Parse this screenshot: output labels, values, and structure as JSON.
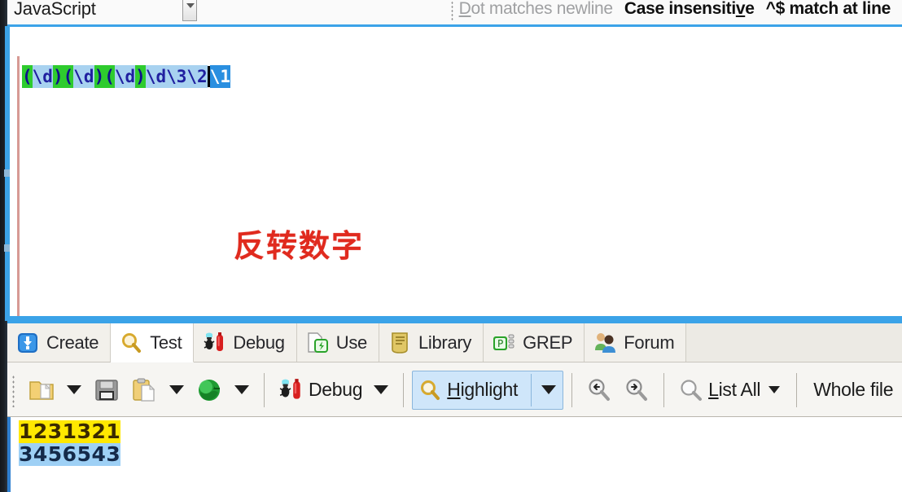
{
  "topbar": {
    "language": "JavaScript",
    "language_dropdown_icon": "chevron-down-icon",
    "options": [
      {
        "label": "Dot matches newline",
        "state": "disabled",
        "accel": "D"
      },
      {
        "label": "Case insensitive",
        "state": "enabled",
        "accel": "v"
      },
      {
        "label": "^$ match at line",
        "state": "enabled",
        "accel": ""
      }
    ]
  },
  "regex": {
    "pattern": "(\\d)(\\d)(\\d)\\d\\3\\2\\1",
    "tokens": [
      {
        "text": "(",
        "kind": "group"
      },
      {
        "text": "\\d",
        "kind": "literal"
      },
      {
        "text": ")",
        "kind": "group"
      },
      {
        "text": "(",
        "kind": "group"
      },
      {
        "text": "\\d",
        "kind": "literal"
      },
      {
        "text": ")",
        "kind": "group"
      },
      {
        "text": "(",
        "kind": "group"
      },
      {
        "text": "\\d",
        "kind": "literal"
      },
      {
        "text": ")",
        "kind": "group"
      },
      {
        "text": "\\d\\3\\2",
        "kind": "literal"
      },
      {
        "text": "\\1",
        "kind": "selected"
      }
    ],
    "annotation": "反转数字"
  },
  "tabs": [
    {
      "label": "Create",
      "icon": "create-icon",
      "active": false
    },
    {
      "label": "Test",
      "icon": "test-icon",
      "active": true
    },
    {
      "label": "Debug",
      "icon": "debug-icon",
      "active": false
    },
    {
      "label": "Use",
      "icon": "use-icon",
      "active": false
    },
    {
      "label": "Library",
      "icon": "library-icon",
      "active": false
    },
    {
      "label": "GREP",
      "icon": "grep-icon",
      "active": false
    },
    {
      "label": "Forum",
      "icon": "forum-icon",
      "active": false
    }
  ],
  "toolbar": {
    "open_icon": "folder-open-icon",
    "save_icon": "floppy-save-icon",
    "paste_icon": "paste-icon",
    "globe_icon": "globe-icon",
    "debug_label": "Debu",
    "debug_accel": "g",
    "debug_icon": "debug-icon",
    "highlight_accel": "H",
    "highlight_label": "ighlight",
    "highlight_icon": "magnifier-icon",
    "find_prev_icon": "find-previous-icon",
    "find_next_icon": "find-next-icon",
    "list_all_accel": "L",
    "list_all_label": "ist All",
    "list_all_icon": "magnifier-icon",
    "scope_label": "Whole file"
  },
  "subject": {
    "lines": [
      {
        "text": "1231321",
        "highlight": "match-even"
      },
      {
        "text": "3456543",
        "highlight": "match-odd"
      }
    ]
  },
  "colors": {
    "accent_blue": "#3ba3e8",
    "group_green": "#2ecb2e",
    "literal_blue": "#a8d2f0",
    "selection_blue": "#2a8fe0",
    "match_yellow": "#ffe800",
    "match_blue": "#9ed0f5",
    "annotation_red": "#e02a1e"
  }
}
